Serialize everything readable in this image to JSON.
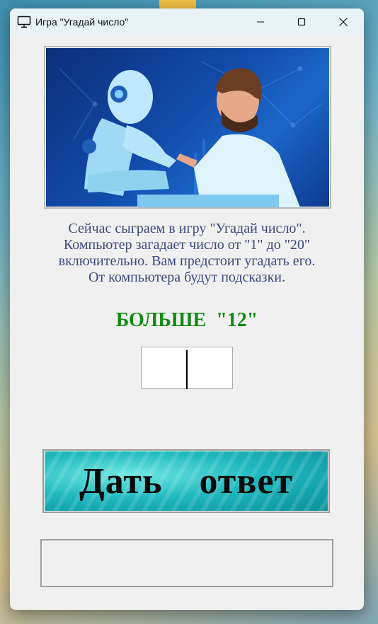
{
  "window": {
    "title": "Игра \"Угадай число\"",
    "controls": {
      "minimize": "minimize",
      "maximize": "maximize",
      "close": "close"
    }
  },
  "game": {
    "description_lines": [
      "Сейчас сыграем в игру \"Угадай число\".",
      "Компьютер загадает число от \"1\" до \"20\"",
      "включительно. Вам предстоит угадать его.",
      "От компьютера будут подсказки."
    ],
    "hint": "БОЛЬШЕ  \"12\"",
    "answer_value": "",
    "submit_label": "Дать  ответ",
    "result_text": ""
  },
  "colors": {
    "hint": "#128a13",
    "description": "#3e4a7c",
    "window_bg": "#f0f0f0",
    "titlebar": "#e8f2f7"
  },
  "icons": [
    "monitor-icon",
    "minimize-icon",
    "maximize-icon",
    "close-icon"
  ]
}
